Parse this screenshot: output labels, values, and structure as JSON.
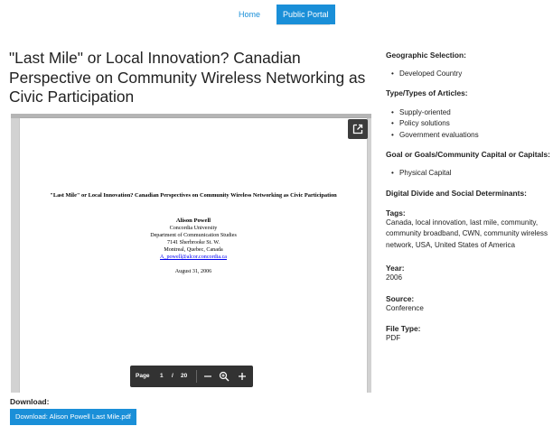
{
  "nav": {
    "home": "Home",
    "portal": "Public Portal"
  },
  "title": "\"Last Mile\" or Local Innovation? Canadian Perspective on Community Wireless Networking as Civic Participation",
  "pdf": {
    "title": "\"Last Mile\" or Local Innovation?  Canadian Perspectives on Community Wireless Networking as Civic Participation",
    "author": "Alison Powell",
    "affiliation": "Concordia University",
    "department": "Department of Communication Studies",
    "street": "7141 Sherbrooke St. W.",
    "city": "Montreal, Quebec, Canada",
    "email": "A_powell@alcor.concordia.ca",
    "date": "August 31, 2006",
    "toolbar": {
      "page_label": "Page",
      "current_page": "1",
      "separator": "/",
      "total_pages": "20"
    }
  },
  "download": {
    "label": "Download:",
    "button": "Download: Alison Powell Last Mile.pdf"
  },
  "sidebar": {
    "geo_heading": "Geographic Selection:",
    "geo_items": [
      "Developed Country"
    ],
    "types_heading": "Type/Types of Articles:",
    "types_items": [
      "Supply-oriented",
      "Policy solutions",
      "Government evaluations"
    ],
    "goals_heading": "Goal or Goals/Community Capital or Capitals:",
    "goals_items": [
      "Physical Capital"
    ],
    "divide_heading": "Digital Divide and Social Determinants:",
    "tags_heading": "Tags:",
    "tags_value": "Canada, local innovation, last mile, community, community broadband, CWN, community wireless network, USA, United States of America",
    "year_heading": "Year:",
    "year_value": "2006",
    "source_heading": "Source:",
    "source_value": "Conference",
    "filetype_heading": "File Type:",
    "filetype_value": "PDF"
  }
}
